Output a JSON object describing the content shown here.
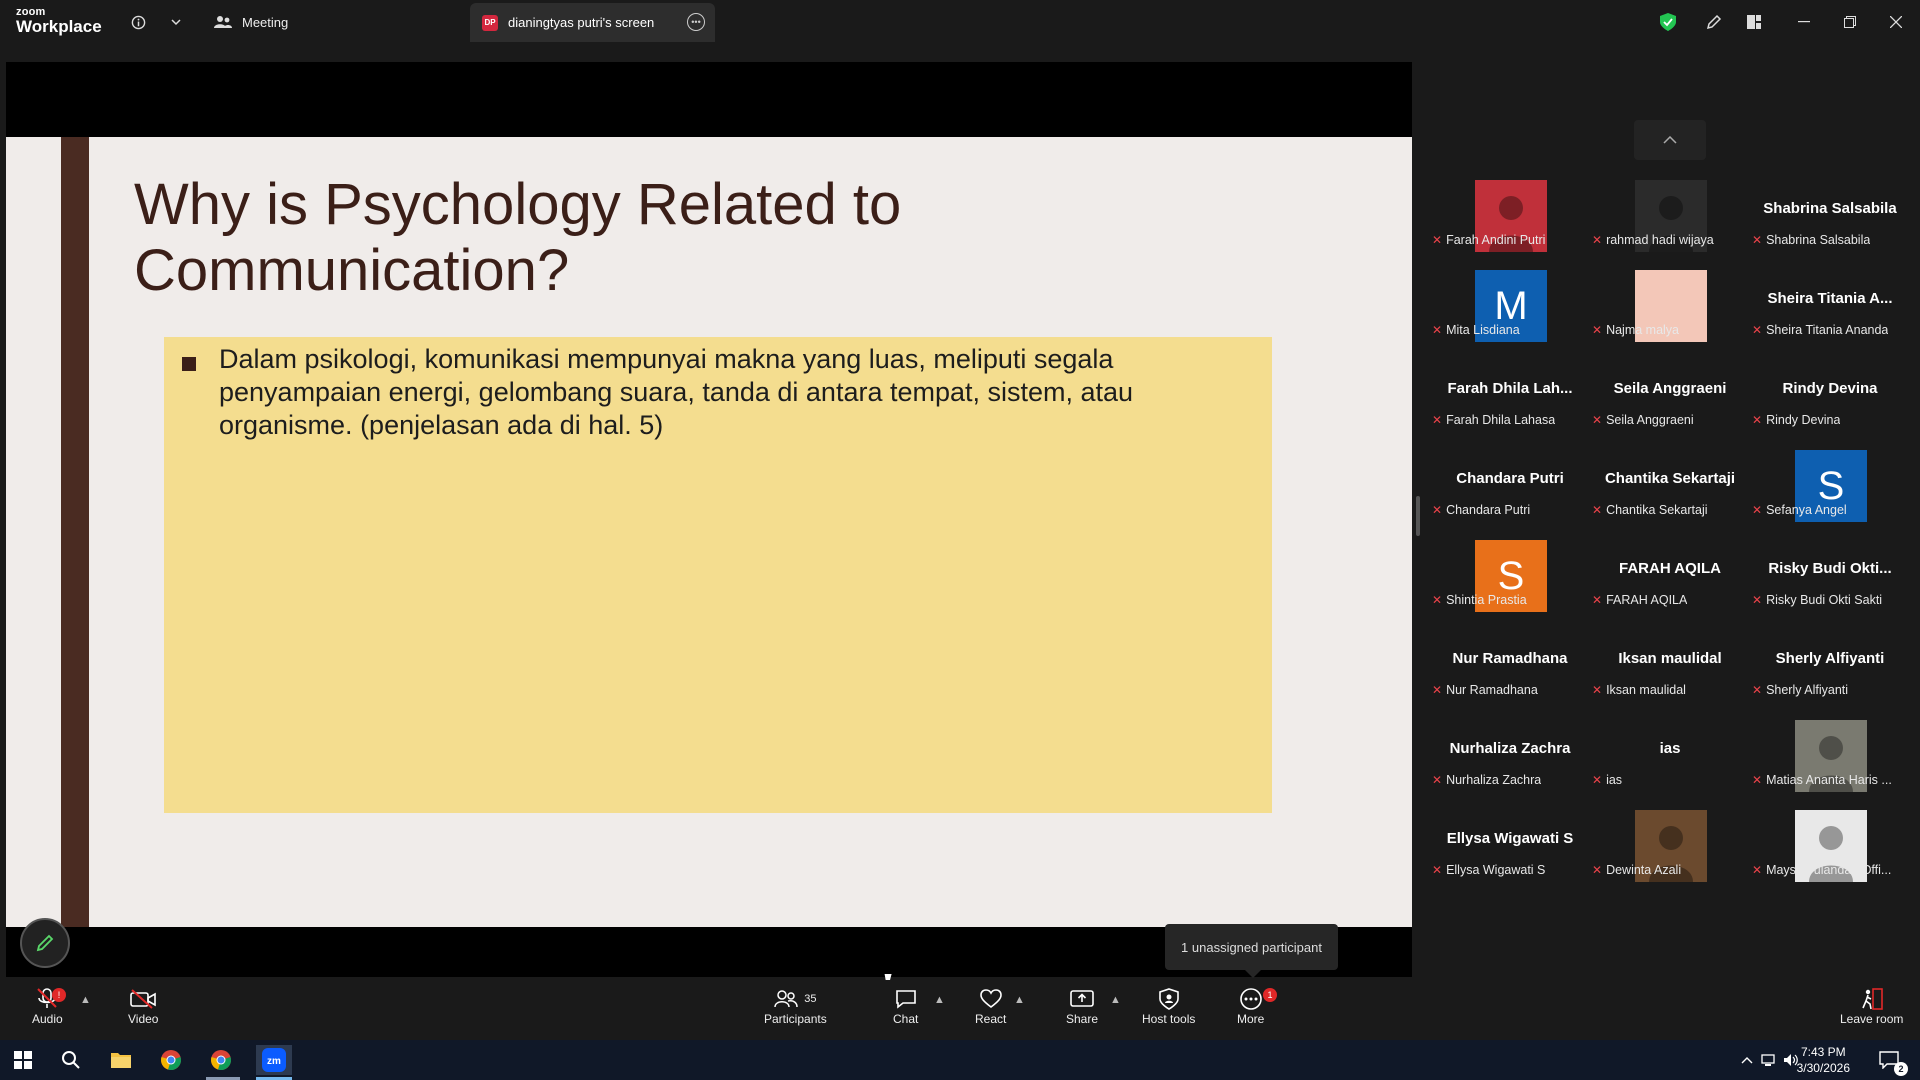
{
  "app": {
    "logo_top": "zoom",
    "logo_bottom": "Workplace"
  },
  "titlebar": {
    "meeting_tab": "Meeting",
    "screen_tab_badge": "DP",
    "screen_tab_label": "dianingtyas putri's screen"
  },
  "slide": {
    "title": "Why is Psychology Related to Communication?",
    "bullet": "Dalam psikologi, komunikasi mempunyai makna yang luas, meliputi segala penyampaian energi, gelombang suara, tanda di antara tempat, sistem, atau organisme. (penjelasan ada di hal. 5)"
  },
  "tooltip": "1 unassigned participant",
  "participants": [
    {
      "tile": "",
      "label": "Farah Andini Putri",
      "avatar": "photo",
      "color": "#c0303a"
    },
    {
      "tile": "",
      "label": "rahmad hadi wijaya",
      "avatar": "photo",
      "color": "#2b2b2b"
    },
    {
      "tile": "Shabrina Salsabila",
      "label": "Shabrina Salsabila",
      "avatar": "none"
    },
    {
      "tile": "",
      "label": "Mita Lisdiana",
      "avatar": "M",
      "color": "#0e5fb0"
    },
    {
      "tile": "",
      "label": "Najma malya",
      "avatar": "blank",
      "color": "#f3c7b8"
    },
    {
      "tile": "Sheira Titania A...",
      "label": "Sheira Titania Ananda",
      "avatar": "none"
    },
    {
      "tile": "Farah Dhila Lah...",
      "label": "Farah Dhila Lahasa",
      "avatar": "none"
    },
    {
      "tile": "Seila Anggraeni",
      "label": "Seila Anggraeni",
      "avatar": "none"
    },
    {
      "tile": "Rindy Devina",
      "label": "Rindy Devina",
      "avatar": "none"
    },
    {
      "tile": "Chandara Putri",
      "label": "Chandara Putri",
      "avatar": "none"
    },
    {
      "tile": "Chantika Sekartaji",
      "label": "Chantika Sekartaji",
      "avatar": "none"
    },
    {
      "tile": "",
      "label": "Sefanya Angel",
      "avatar": "S",
      "color": "#0e5fb0"
    },
    {
      "tile": "",
      "label": "Shintia Prastia",
      "avatar": "S",
      "color": "#e8701a"
    },
    {
      "tile": "FARAH AQILA",
      "label": "FARAH AQILA",
      "avatar": "none"
    },
    {
      "tile": "Risky Budi Okti...",
      "label": "Risky Budi Okti Sakti",
      "avatar": "none"
    },
    {
      "tile": "Nur Ramadhana",
      "label": "Nur Ramadhana",
      "avatar": "none"
    },
    {
      "tile": "Iksan maulidal",
      "label": "Iksan maulidal",
      "avatar": "none"
    },
    {
      "tile": "Sherly Alfiyanti",
      "label": "Sherly Alfiyanti",
      "avatar": "none"
    },
    {
      "tile": "Nurhaliza Zachra",
      "label": "Nurhaliza Zachra",
      "avatar": "none"
    },
    {
      "tile": "ias",
      "label": "ias",
      "avatar": "none"
    },
    {
      "tile": "",
      "label": "Matias Ananta Haris ...",
      "avatar": "photo",
      "color": "#7a7a70"
    },
    {
      "tile": "Ellysa Wigawati S",
      "label": "Ellysa Wigawati S",
      "avatar": "none"
    },
    {
      "tile": "",
      "label": "Dewinta Azali",
      "avatar": "photo",
      "color": "#6b4a2e"
    },
    {
      "tile": "",
      "label": "Maysi Wulandari Offi...",
      "avatar": "photo",
      "color": "#e8e8e8"
    }
  ],
  "toolbar": {
    "audio": "Audio",
    "video": "Video",
    "participants": "Participants",
    "participants_count": "35",
    "chat": "Chat",
    "react": "React",
    "share": "Share",
    "host_tools": "Host tools",
    "more": "More",
    "more_badge": "1",
    "leave": "Leave room"
  },
  "taskbar": {
    "time": "7:43 PM",
    "date": "3/30/2026",
    "notif_count": "2"
  },
  "colors": {
    "accent_green": "#23c552",
    "mute_red": "#e9434a",
    "slide_title": "#3b1f18",
    "slide_box": "#f4dd8f"
  }
}
